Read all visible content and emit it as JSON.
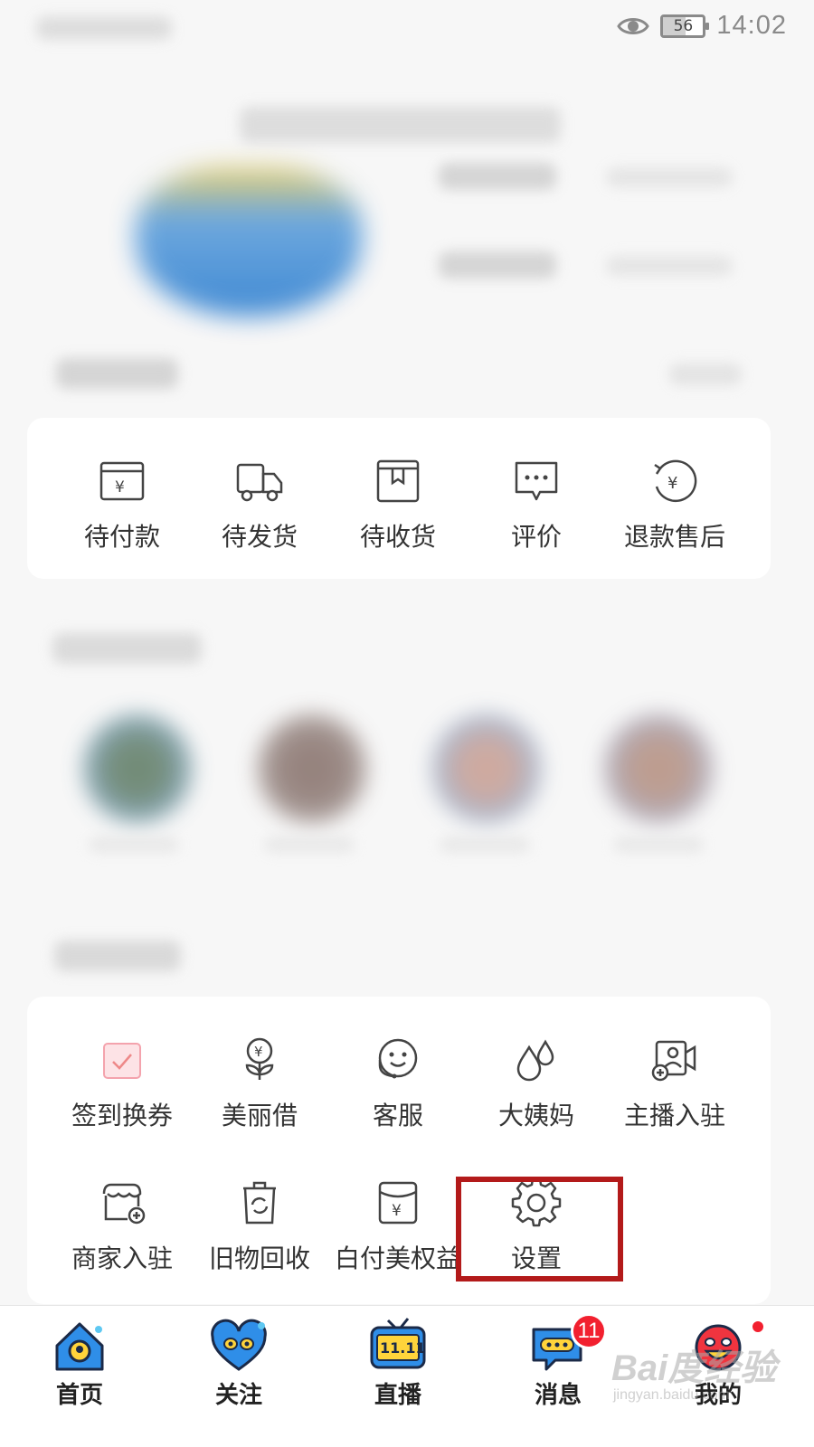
{
  "status_bar": {
    "time": "14:02",
    "battery": "56",
    "battery_level": 0.56
  },
  "orders": [
    {
      "label": "待付款",
      "icon": "wallet-yen-icon"
    },
    {
      "label": "待发货",
      "icon": "truck-icon"
    },
    {
      "label": "待收货",
      "icon": "package-icon"
    },
    {
      "label": "评价",
      "icon": "chat-bubble-icon"
    },
    {
      "label": "退款售后",
      "icon": "refund-yen-icon"
    }
  ],
  "tools": [
    {
      "label": "签到换券",
      "icon": "checkin-calendar-icon"
    },
    {
      "label": "美丽借",
      "icon": "money-plant-icon"
    },
    {
      "label": "客服",
      "icon": "customer-service-icon"
    },
    {
      "label": "大姨妈",
      "icon": "droplets-icon"
    },
    {
      "label": "主播入驻",
      "icon": "streamer-camera-icon"
    },
    {
      "label": "商家入驻",
      "icon": "shop-add-icon"
    },
    {
      "label": "旧物回收",
      "icon": "recycle-bin-icon"
    },
    {
      "label": "白付美权益",
      "icon": "yen-card-icon"
    },
    {
      "label": "设置",
      "icon": "gear-icon"
    }
  ],
  "tab_bar": {
    "tabs": [
      {
        "label": "首页",
        "icon": "home-icon"
      },
      {
        "label": "关注",
        "icon": "heart-icon"
      },
      {
        "label": "直播",
        "icon": "live-tv-1111-icon",
        "icon_text": "11.11"
      },
      {
        "label": "消息",
        "icon": "message-icon",
        "badge": "11"
      },
      {
        "label": "我的",
        "icon": "profile-face-icon"
      }
    ]
  },
  "watermark": {
    "main": "Bai度经验",
    "sub": "jingyan.baidu.com"
  },
  "colors": {
    "highlight": "#b31a1a",
    "badge": "#f2202f",
    "tab_accent": "#2f8ee8"
  }
}
